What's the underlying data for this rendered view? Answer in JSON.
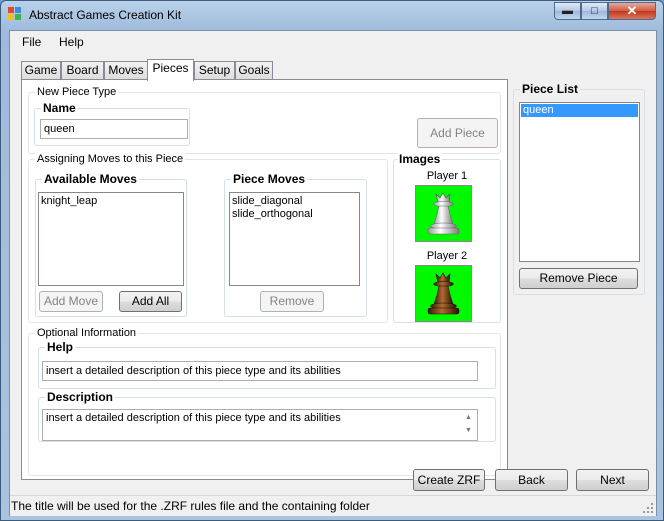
{
  "window": {
    "title": "Abstract Games Creation Kit"
  },
  "menu": {
    "file": "File",
    "help": "Help"
  },
  "tabs": [
    {
      "label": "Game"
    },
    {
      "label": "Board"
    },
    {
      "label": "Moves"
    },
    {
      "label": "Pieces",
      "active": true
    },
    {
      "label": "Setup"
    },
    {
      "label": "Goals"
    }
  ],
  "new_piece": {
    "group_label": "New Piece Type",
    "name_label": "Name",
    "name_value": "queen",
    "add_piece_button": "Add Piece"
  },
  "assign_moves": {
    "group_label": "Assigning Moves to this Piece",
    "available_label": "Available Moves",
    "available_items": [
      "knight_leap"
    ],
    "add_move_button": "Add Move",
    "add_all_button": "Add All",
    "piece_moves_label": "Piece Moves",
    "piece_moves_items": [
      "slide_diagonal",
      "slide_orthogonal"
    ],
    "remove_button": "Remove"
  },
  "images": {
    "label": "Images",
    "player1": "Player 1",
    "player2": "Player 2",
    "image_background": "#00f800"
  },
  "optional": {
    "group_label": "Optional Information",
    "help_label": "Help",
    "help_value": "insert a detailed description of this piece type and its abilities",
    "description_label": "Description",
    "description_value": "insert a detailed description of this piece type and its abilities"
  },
  "piece_list": {
    "label": "Piece List",
    "items": [
      "queen"
    ],
    "selected": "queen",
    "remove_button": "Remove Piece",
    "selection_color": "#3399ff"
  },
  "footer": {
    "create_zrf": "Create ZRF",
    "back": "Back",
    "next": "Next"
  },
  "status": {
    "text": "The title will be used for the .ZRF rules file and the containing folder"
  }
}
